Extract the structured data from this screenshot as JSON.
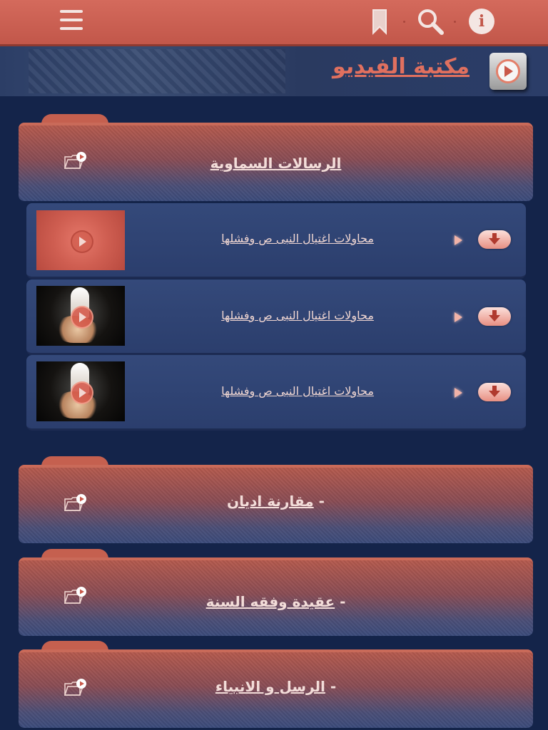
{
  "header": {
    "page_title": "مكتبة الفيديو",
    "icons": [
      "menu-icon",
      "bookmark-icon",
      "search-icon",
      "info-icon"
    ],
    "info_glyph": "i"
  },
  "colors": {
    "topbar": "#c2574a",
    "title_text": "#e0705f",
    "background": "#14244a",
    "card_accent": "#c96a59"
  },
  "sections": [
    {
      "title": "الرسالات السماوية",
      "videos": [
        {
          "title": "محاولات اغتيال النبى ص وفشلها",
          "thumb": "red"
        },
        {
          "title": "محاولات اغتيال النبى ص وفشلها",
          "thumb": "dark"
        },
        {
          "title": "محاولات اغتيال النبى ص وفشلها",
          "thumb": "dark"
        }
      ]
    },
    {
      "prefix": "- ",
      "title": "مقارنة اديان"
    },
    {
      "prefix": "- ",
      "title": "عقيدة وفقه السنة"
    },
    {
      "prefix": "- ",
      "title": "الرسل و الانبياء"
    }
  ]
}
